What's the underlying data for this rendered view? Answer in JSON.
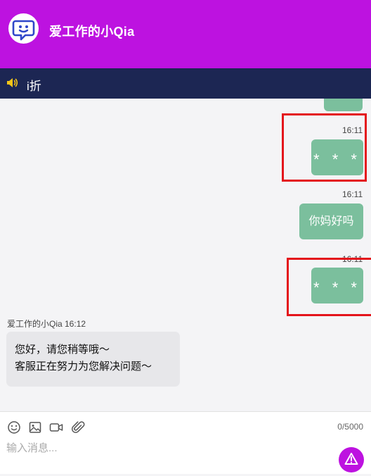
{
  "header": {
    "title": "爱工作的小Qia",
    "avatar_icon": "chat-bot-icon",
    "color": "#bd12e0"
  },
  "notice": {
    "icon": "speaker-icon",
    "text": "i折",
    "background": "#1c2653"
  },
  "messages": [
    {
      "from": "me",
      "time": "16:11",
      "text": "* * *",
      "highlighted": true
    },
    {
      "from": "me",
      "time": "16:11",
      "text": "你妈好吗",
      "highlighted": false
    },
    {
      "from": "me",
      "time": "16:11",
      "text": "* * *",
      "highlighted": true
    },
    {
      "from": "agent",
      "sender": "爱工作的小Qia 16:12",
      "lines": [
        "您好，请您稍等哦～",
        "客服正在努力为您解决问题～"
      ]
    }
  ],
  "composer": {
    "tools": [
      "emoji-icon",
      "image-icon",
      "video-icon",
      "attachment-icon"
    ],
    "counter": "0/5000",
    "placeholder": "输入消息...",
    "send_icon": "send-icon"
  },
  "colors": {
    "my_bubble": "#7bbf9d",
    "agent_bubble": "#e7e7ea",
    "highlight_box": "#e4141b"
  }
}
